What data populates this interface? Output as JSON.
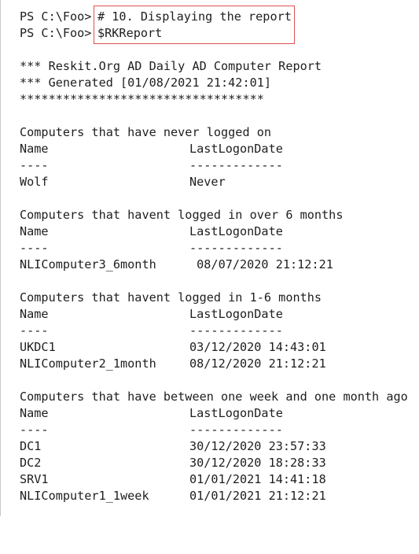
{
  "console": {
    "prompt": "PS C:\\Foo>",
    "commands": [
      "# 10. Displaying the report",
      "$RKReport"
    ],
    "header": {
      "title_line": "*** Reskit.Org AD Daily AD Computer Report",
      "generated_line": "*** Generated [01/08/2021 21:42:01]",
      "stars_line": "**********************************"
    },
    "sections": [
      {
        "title": "Computers that have never logged on",
        "col_name": "Name",
        "col_date": "LastLogonDate",
        "sep_name": "----",
        "sep_date": "-------------",
        "rows": [
          {
            "name": "Wolf",
            "date": "Never"
          }
        ]
      },
      {
        "title": "Computers that havent logged in over 6 months",
        "col_name": "Name",
        "col_date": "LastLogonDate",
        "sep_name": "----",
        "sep_date": "-------------",
        "rows": [
          {
            "name": "NLIComputer3_6month",
            "date": " 08/07/2020 21:12:21"
          }
        ]
      },
      {
        "title": "Computers that havent logged in 1-6 months",
        "col_name": "Name",
        "col_date": "LastLogonDate",
        "sep_name": "----",
        "sep_date": "-------------",
        "rows": [
          {
            "name": "UKDC1",
            "date": "03/12/2020 14:43:01"
          },
          {
            "name": "NLIComputer2_1month",
            "date": "08/12/2020 21:12:21"
          }
        ]
      },
      {
        "title": "Computers that have between one week and one month ago",
        "col_name": "Name",
        "col_date": "LastLogonDate",
        "sep_name": "----",
        "sep_date": "-------------",
        "rows": [
          {
            "name": "DC1",
            "date": "30/12/2020 23:57:33"
          },
          {
            "name": "DC2",
            "date": "30/12/2020 18:28:33"
          },
          {
            "name": "SRV1",
            "date": "01/01/2021 14:41:18"
          },
          {
            "name": "NLIComputer1_1week",
            "date": "01/01/2021 21:12:21"
          }
        ]
      }
    ],
    "colors": {
      "text": "#1e1e1e",
      "background": "#ffffff",
      "highlight_border": "#d9534f"
    }
  }
}
